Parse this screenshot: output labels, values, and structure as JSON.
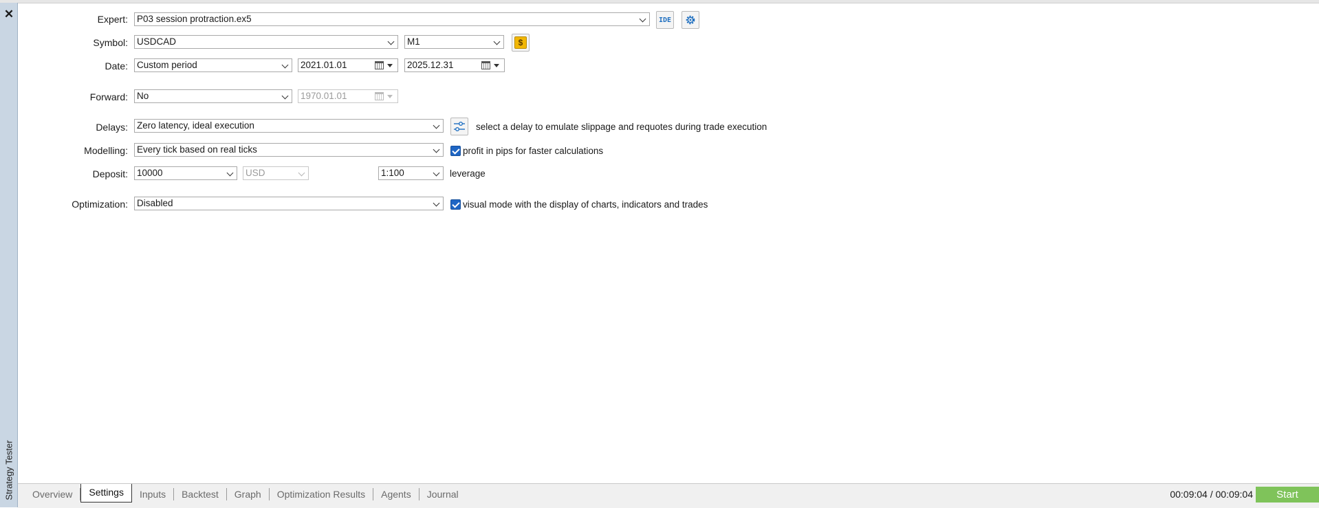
{
  "panel": {
    "title": "Strategy Tester",
    "close_symbol": "✕"
  },
  "form": {
    "expert": {
      "label": "Expert:",
      "value": "P03 session protraction.ex5",
      "ide_label": "IDE"
    },
    "symbol": {
      "label": "Symbol:",
      "value": "USDCAD",
      "timeframe": "M1",
      "icon": "dollar-icon"
    },
    "date": {
      "label": "Date:",
      "period": "Custom period",
      "from": "2021.01.01",
      "to": "2025.12.31"
    },
    "forward": {
      "label": "Forward:",
      "value": "No",
      "date": "1970.01.01"
    },
    "delays": {
      "label": "Delays:",
      "value": "Zero latency, ideal execution",
      "hint": "select a delay to emulate slippage and requotes during trade execution"
    },
    "modelling": {
      "label": "Modelling:",
      "value": "Every tick based on real ticks",
      "checkbox_label": "profit in pips for faster calculations",
      "checked": true
    },
    "deposit": {
      "label": "Deposit:",
      "value": "10000",
      "currency": "USD",
      "leverage_value": "1:100",
      "leverage_label": "leverage"
    },
    "optimization": {
      "label": "Optimization:",
      "value": "Disabled",
      "checkbox_label": "visual mode with the display of charts, indicators and trades",
      "checked": true
    }
  },
  "tabs": [
    {
      "label": "Overview"
    },
    {
      "label": "Settings",
      "active": true
    },
    {
      "label": "Inputs"
    },
    {
      "label": "Backtest"
    },
    {
      "label": "Graph"
    },
    {
      "label": "Optimization Results"
    },
    {
      "label": "Agents"
    },
    {
      "label": "Journal"
    }
  ],
  "status": {
    "timer": "00:09:04 / 00:09:04",
    "start_label": "Start"
  },
  "colors": {
    "accent": "#1f66c4",
    "start": "#7fc35a",
    "sidebar": "#c9d6e3",
    "dollar": "#f2b705"
  }
}
